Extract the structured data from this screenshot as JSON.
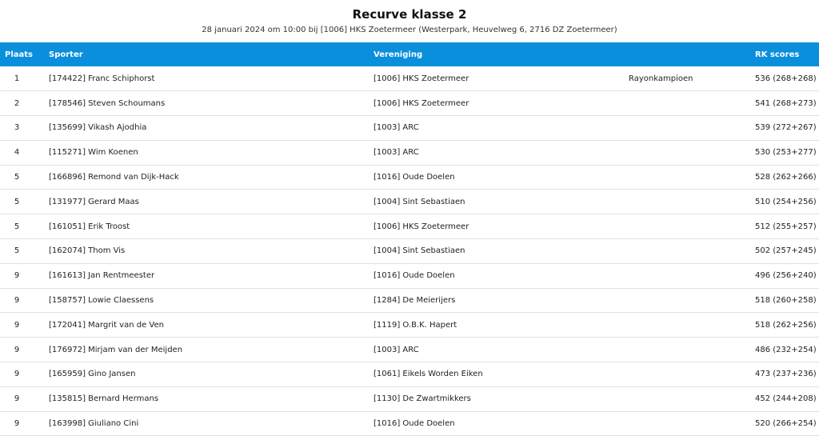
{
  "page": {
    "title": "Recurve klasse 2",
    "subtitle": "28 januari 2024 om 10:00 bij [1006] HKS Zoetermeer (Westerpark, Heuvelweg 6, 2716 DZ Zoetermeer)"
  },
  "table": {
    "headers": {
      "plaats": "Plaats",
      "sporter": "Sporter",
      "vereniging": "Vereniging",
      "rk_scores": "RK scores"
    },
    "rows": [
      {
        "plaats": "1",
        "sporter": "[174422] Franc Schiphorst",
        "vereniging": "[1006] HKS Zoetermeer",
        "badge": "Rayonkampioen",
        "score": "536 (268+268)"
      },
      {
        "plaats": "2",
        "sporter": "[178546] Steven Schoumans",
        "vereniging": "[1006] HKS Zoetermeer",
        "badge": "",
        "score": "541 (268+273)"
      },
      {
        "plaats": "3",
        "sporter": "[135699] Vikash Ajodhia",
        "vereniging": "[1003] ARC",
        "badge": "",
        "score": "539 (272+267)"
      },
      {
        "plaats": "4",
        "sporter": "[115271] Wim Koenen",
        "vereniging": "[1003] ARC",
        "badge": "",
        "score": "530 (253+277)"
      },
      {
        "plaats": "5",
        "sporter": "[166896] Remond van Dijk-Hack",
        "vereniging": "[1016] Oude Doelen",
        "badge": "",
        "score": "528 (262+266)"
      },
      {
        "plaats": "5",
        "sporter": "[131977] Gerard Maas",
        "vereniging": "[1004] Sint Sebastiaen",
        "badge": "",
        "score": "510 (254+256)"
      },
      {
        "plaats": "5",
        "sporter": "[161051] Erik Troost",
        "vereniging": "[1006] HKS Zoetermeer",
        "badge": "",
        "score": "512 (255+257)"
      },
      {
        "plaats": "5",
        "sporter": "[162074] Thom Vis",
        "vereniging": "[1004] Sint Sebastiaen",
        "badge": "",
        "score": "502 (257+245)"
      },
      {
        "plaats": "9",
        "sporter": "[161613] Jan Rentmeester",
        "vereniging": "[1016] Oude Doelen",
        "badge": "",
        "score": "496 (256+240)"
      },
      {
        "plaats": "9",
        "sporter": "[158757] Lowie Claessens",
        "vereniging": "[1284] De Meierijers",
        "badge": "",
        "score": "518 (260+258)"
      },
      {
        "plaats": "9",
        "sporter": "[172041] Margrit van de Ven",
        "vereniging": "[1119] O.B.K. Hapert",
        "badge": "",
        "score": "518 (262+256)"
      },
      {
        "plaats": "9",
        "sporter": "[176972] Mirjam van der Meijden",
        "vereniging": "[1003] ARC",
        "badge": "",
        "score": "486 (232+254)"
      },
      {
        "plaats": "9",
        "sporter": "[165959] Gino Jansen",
        "vereniging": "[1061] Eikels Worden Eiken",
        "badge": "",
        "score": "473 (237+236)"
      },
      {
        "plaats": "9",
        "sporter": "[135815] Bernard Hermans",
        "vereniging": "[1130] De Zwartmikkers",
        "badge": "",
        "score": "452 (244+208)"
      },
      {
        "plaats": "9",
        "sporter": "[163998] Giuliano Cini",
        "vereniging": "[1016] Oude Doelen",
        "badge": "",
        "score": "520 (266+254)"
      }
    ]
  }
}
